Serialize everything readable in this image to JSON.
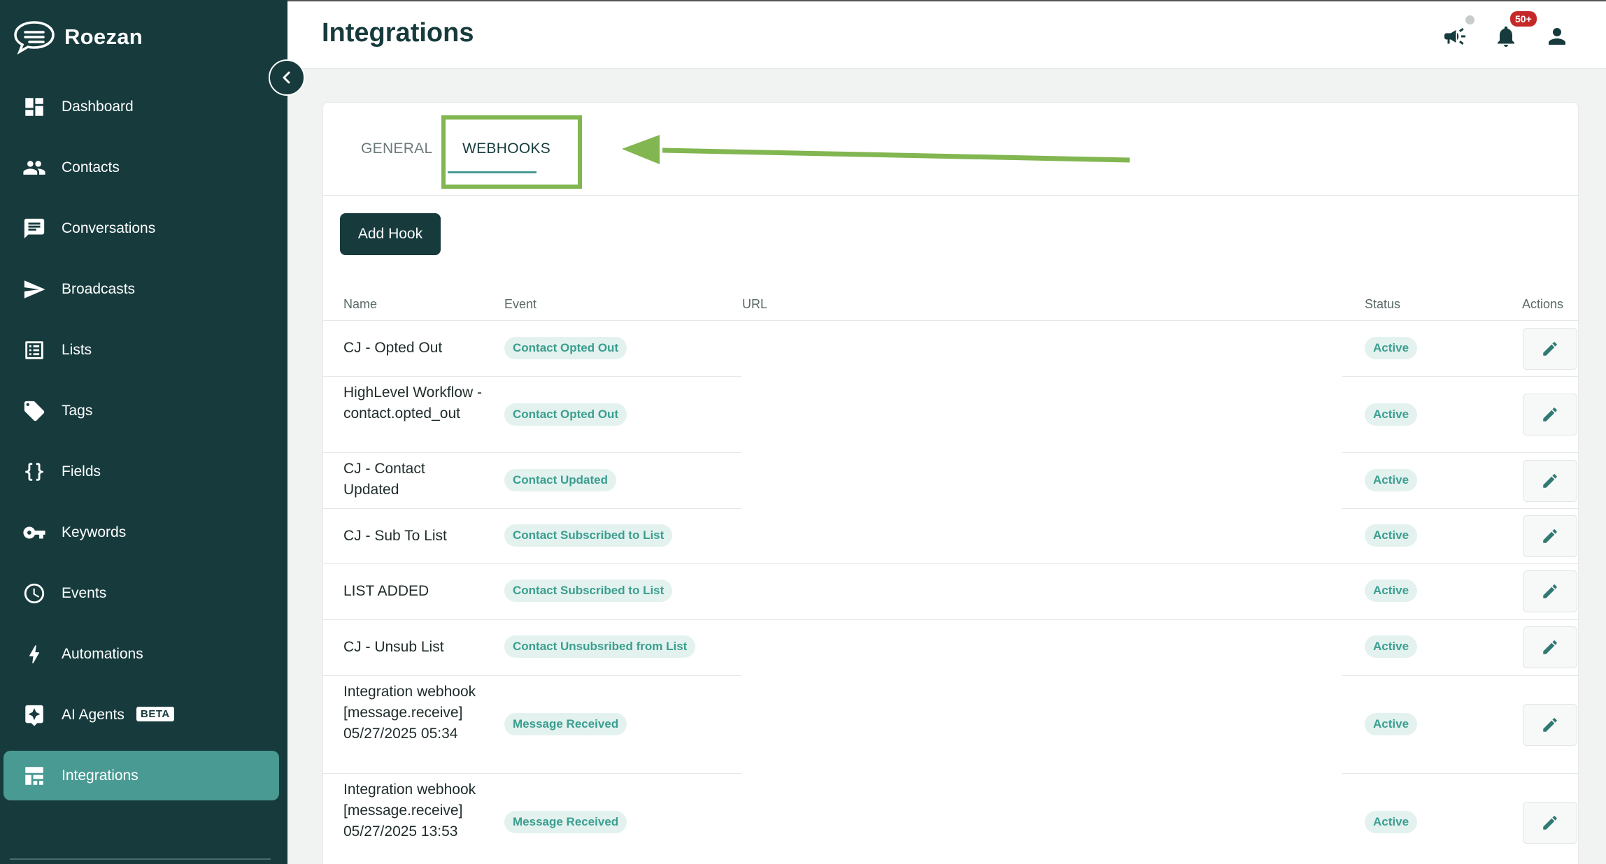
{
  "app": {
    "name": "Roezan"
  },
  "sidebar": {
    "items": [
      {
        "label": "Dashboard",
        "icon": "dashboard-icon"
      },
      {
        "label": "Contacts",
        "icon": "contacts-icon"
      },
      {
        "label": "Conversations",
        "icon": "conversations-icon"
      },
      {
        "label": "Broadcasts",
        "icon": "send-icon"
      },
      {
        "label": "Lists",
        "icon": "list-icon"
      },
      {
        "label": "Tags",
        "icon": "tag-icon"
      },
      {
        "label": "Fields",
        "icon": "braces-icon"
      },
      {
        "label": "Keywords",
        "icon": "key-icon"
      },
      {
        "label": "Events",
        "icon": "clock-icon"
      },
      {
        "label": "Automations",
        "icon": "bolt-icon"
      },
      {
        "label": "AI Agents",
        "icon": "sparkle-icon",
        "badge": "BETA"
      },
      {
        "label": "Integrations",
        "icon": "integrations-icon",
        "active": true
      }
    ]
  },
  "header": {
    "title": "Integrations",
    "notification_count": "50+"
  },
  "tabs": [
    {
      "label": "GENERAL"
    },
    {
      "label": "WEBHOOKS",
      "active": true
    }
  ],
  "add_hook_label": "Add Hook",
  "table": {
    "columns": [
      "Name",
      "Event",
      "URL",
      "Status",
      "Actions"
    ],
    "rows": [
      {
        "name": "CJ - Opted Out",
        "event": "Contact Opted Out",
        "url": "",
        "status": "Active"
      },
      {
        "name": "HighLevel Workflow - contact.opted_out",
        "event": "Contact Opted Out",
        "url": "",
        "status": "Active"
      },
      {
        "name": "CJ - Contact Updated",
        "event": "Contact Updated",
        "url": "",
        "status": "Active"
      },
      {
        "name": "CJ - Sub To List",
        "event": "Contact Subscribed to List",
        "url": "",
        "status": "Active"
      },
      {
        "name": "LIST ADDED",
        "event": "Contact Subscribed to List",
        "url": "",
        "status": "Active"
      },
      {
        "name": "CJ - Unsub List",
        "event": "Contact Unsubsribed from List",
        "url": "",
        "status": "Active"
      },
      {
        "name": "Integration webhook [message.receive] 05/27/2025 05:34",
        "event": "Message Received",
        "url": "",
        "status": "Active"
      },
      {
        "name": "Integration webhook [message.receive] 05/27/2025 13:53",
        "event": "Message Received",
        "url": "",
        "status": "Active"
      }
    ]
  },
  "colors": {
    "sidebar_bg": "#173b3d",
    "active_nav": "#4a9a94",
    "badge_bg": "#e3f2ef",
    "badge_text": "#3b9e8f",
    "annotation": "#82b651",
    "notification": "#c62828"
  }
}
